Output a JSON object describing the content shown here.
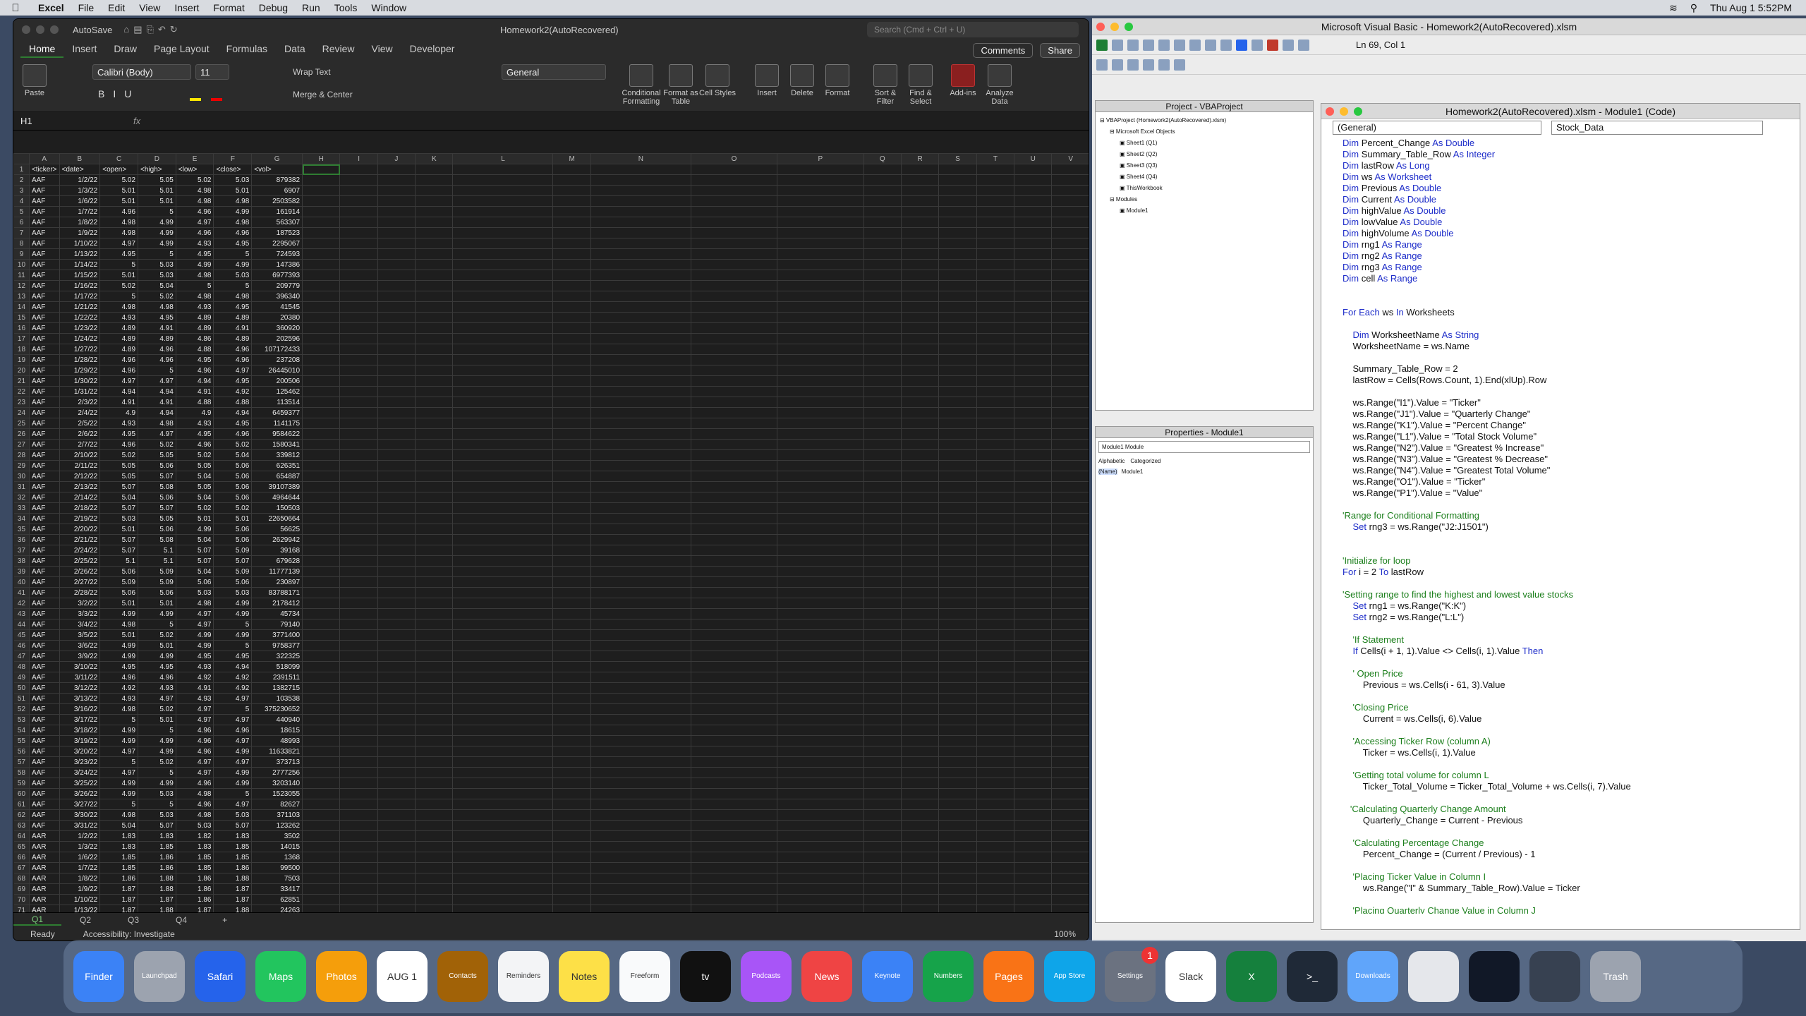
{
  "menubar": {
    "app": "Excel",
    "items": [
      "File",
      "Edit",
      "View",
      "Insert",
      "Format",
      "Debug",
      "Run",
      "Tools",
      "Window"
    ],
    "clock": "Thu Aug 1  5:52PM"
  },
  "excel": {
    "autosave": "AutoSave",
    "doc_title": "Homework2(AutoRecovered)",
    "search_placeholder": "Search (Cmd + Ctrl + U)",
    "tabs": [
      "Home",
      "Insert",
      "Draw",
      "Page Layout",
      "Formulas",
      "Data",
      "Review",
      "View",
      "Developer"
    ],
    "comments": "Comments",
    "share": "Share",
    "font": "Calibri (Body)",
    "size": "11",
    "format": "General",
    "wrap": "Wrap Text",
    "merge": "Merge & Center",
    "paste": "Paste",
    "groups": [
      "Conditional Formatting",
      "Format as Table",
      "Cell Styles",
      "Insert",
      "Delete",
      "Format",
      "Sort & Filter",
      "Find & Select",
      "Add-ins",
      "Analyze Data"
    ],
    "namebox": "H1",
    "fx": "fx",
    "columns": [
      "A",
      "B",
      "C",
      "D",
      "E",
      "F",
      "G",
      "H",
      "I",
      "J",
      "K",
      "L",
      "M",
      "N",
      "O",
      "P",
      "Q",
      "R",
      "S",
      "T",
      "U",
      "V"
    ],
    "headers": [
      "<ticker>",
      "<date>",
      "<open>",
      "<high>",
      "<low>",
      "<close>",
      "<vol>"
    ],
    "rows": [
      [
        "AAF",
        "1/2/22",
        "5.02",
        "5.05",
        "5.02",
        "5.03",
        "879382"
      ],
      [
        "AAF",
        "1/3/22",
        "5.01",
        "5.01",
        "4.98",
        "5.01",
        "6907"
      ],
      [
        "AAF",
        "1/6/22",
        "5.01",
        "5.01",
        "4.98",
        "4.98",
        "2503582"
      ],
      [
        "AAF",
        "1/7/22",
        "4.96",
        "5",
        "4.96",
        "4.99",
        "161914"
      ],
      [
        "AAF",
        "1/8/22",
        "4.98",
        "4.99",
        "4.97",
        "4.98",
        "563307"
      ],
      [
        "AAF",
        "1/9/22",
        "4.98",
        "4.99",
        "4.96",
        "4.96",
        "187523"
      ],
      [
        "AAF",
        "1/10/22",
        "4.97",
        "4.99",
        "4.93",
        "4.95",
        "2295067"
      ],
      [
        "AAF",
        "1/13/22",
        "4.95",
        "5",
        "4.95",
        "5",
        "724593"
      ],
      [
        "AAF",
        "1/14/22",
        "5",
        "5.03",
        "4.99",
        "4.99",
        "147386"
      ],
      [
        "AAF",
        "1/15/22",
        "5.01",
        "5.03",
        "4.98",
        "5.03",
        "6977393"
      ],
      [
        "AAF",
        "1/16/22",
        "5.02",
        "5.04",
        "5",
        "5",
        "209779"
      ],
      [
        "AAF",
        "1/17/22",
        "5",
        "5.02",
        "4.98",
        "4.98",
        "396340"
      ],
      [
        "AAF",
        "1/21/22",
        "4.98",
        "4.98",
        "4.93",
        "4.95",
        "41545"
      ],
      [
        "AAF",
        "1/22/22",
        "4.93",
        "4.95",
        "4.89",
        "4.89",
        "20380"
      ],
      [
        "AAF",
        "1/23/22",
        "4.89",
        "4.91",
        "4.89",
        "4.91",
        "360920"
      ],
      [
        "AAF",
        "1/24/22",
        "4.89",
        "4.89",
        "4.86",
        "4.89",
        "202596"
      ],
      [
        "AAF",
        "1/27/22",
        "4.89",
        "4.96",
        "4.88",
        "4.96",
        "107172433"
      ],
      [
        "AAF",
        "1/28/22",
        "4.96",
        "4.96",
        "4.95",
        "4.96",
        "237208"
      ],
      [
        "AAF",
        "1/29/22",
        "4.96",
        "5",
        "4.96",
        "4.97",
        "26445010"
      ],
      [
        "AAF",
        "1/30/22",
        "4.97",
        "4.97",
        "4.94",
        "4.95",
        "200506"
      ],
      [
        "AAF",
        "1/31/22",
        "4.94",
        "4.94",
        "4.91",
        "4.92",
        "125462"
      ],
      [
        "AAF",
        "2/3/22",
        "4.91",
        "4.91",
        "4.88",
        "4.88",
        "113514"
      ],
      [
        "AAF",
        "2/4/22",
        "4.9",
        "4.94",
        "4.9",
        "4.94",
        "6459377"
      ],
      [
        "AAF",
        "2/5/22",
        "4.93",
        "4.98",
        "4.93",
        "4.95",
        "1141175"
      ],
      [
        "AAF",
        "2/6/22",
        "4.95",
        "4.97",
        "4.95",
        "4.96",
        "9584622"
      ],
      [
        "AAF",
        "2/7/22",
        "4.96",
        "5.02",
        "4.96",
        "5.02",
        "1580341"
      ],
      [
        "AAF",
        "2/10/22",
        "5.02",
        "5.05",
        "5.02",
        "5.04",
        "339812"
      ],
      [
        "AAF",
        "2/11/22",
        "5.05",
        "5.06",
        "5.05",
        "5.06",
        "626351"
      ],
      [
        "AAF",
        "2/12/22",
        "5.05",
        "5.07",
        "5.04",
        "5.06",
        "654887"
      ],
      [
        "AAF",
        "2/13/22",
        "5.07",
        "5.08",
        "5.05",
        "5.06",
        "39107389"
      ],
      [
        "AAF",
        "2/14/22",
        "5.04",
        "5.06",
        "5.04",
        "5.06",
        "4964644"
      ],
      [
        "AAF",
        "2/18/22",
        "5.07",
        "5.07",
        "5.02",
        "5.02",
        "150503"
      ],
      [
        "AAF",
        "2/19/22",
        "5.03",
        "5.05",
        "5.01",
        "5.01",
        "22650664"
      ],
      [
        "AAF",
        "2/20/22",
        "5.01",
        "5.06",
        "4.99",
        "5.06",
        "56625"
      ],
      [
        "AAF",
        "2/21/22",
        "5.07",
        "5.08",
        "5.04",
        "5.06",
        "2629942"
      ],
      [
        "AAF",
        "2/24/22",
        "5.07",
        "5.1",
        "5.07",
        "5.09",
        "39168"
      ],
      [
        "AAF",
        "2/25/22",
        "5.1",
        "5.1",
        "5.07",
        "5.07",
        "679628"
      ],
      [
        "AAF",
        "2/26/22",
        "5.06",
        "5.09",
        "5.04",
        "5.09",
        "11777139"
      ],
      [
        "AAF",
        "2/27/22",
        "5.09",
        "5.09",
        "5.06",
        "5.06",
        "230897"
      ],
      [
        "AAF",
        "2/28/22",
        "5.06",
        "5.06",
        "5.03",
        "5.03",
        "83788171"
      ],
      [
        "AAF",
        "3/2/22",
        "5.01",
        "5.01",
        "4.98",
        "4.99",
        "2178412"
      ],
      [
        "AAF",
        "3/3/22",
        "4.99",
        "4.99",
        "4.97",
        "4.99",
        "45734"
      ],
      [
        "AAF",
        "3/4/22",
        "4.98",
        "5",
        "4.97",
        "5",
        "79140"
      ],
      [
        "AAF",
        "3/5/22",
        "5.01",
        "5.02",
        "4.99",
        "4.99",
        "3771400"
      ],
      [
        "AAF",
        "3/6/22",
        "4.99",
        "5.01",
        "4.99",
        "5",
        "9758377"
      ],
      [
        "AAF",
        "3/9/22",
        "4.99",
        "4.99",
        "4.95",
        "4.95",
        "322325"
      ],
      [
        "AAF",
        "3/10/22",
        "4.95",
        "4.95",
        "4.93",
        "4.94",
        "518099"
      ],
      [
        "AAF",
        "3/11/22",
        "4.96",
        "4.96",
        "4.92",
        "4.92",
        "2391511"
      ],
      [
        "AAF",
        "3/12/22",
        "4.92",
        "4.93",
        "4.91",
        "4.92",
        "1382715"
      ],
      [
        "AAF",
        "3/13/22",
        "4.93",
        "4.97",
        "4.93",
        "4.97",
        "103538"
      ],
      [
        "AAF",
        "3/16/22",
        "4.98",
        "5.02",
        "4.97",
        "5",
        "375230652"
      ],
      [
        "AAF",
        "3/17/22",
        "5",
        "5.01",
        "4.97",
        "4.97",
        "440940"
      ],
      [
        "AAF",
        "3/18/22",
        "4.99",
        "5",
        "4.96",
        "4.96",
        "18615"
      ],
      [
        "AAF",
        "3/19/22",
        "4.99",
        "4.99",
        "4.96",
        "4.97",
        "48993"
      ],
      [
        "AAF",
        "3/20/22",
        "4.97",
        "4.99",
        "4.96",
        "4.99",
        "11633821"
      ],
      [
        "AAF",
        "3/23/22",
        "5",
        "5.02",
        "4.97",
        "4.97",
        "373713"
      ],
      [
        "AAF",
        "3/24/22",
        "4.97",
        "5",
        "4.97",
        "4.99",
        "2777256"
      ],
      [
        "AAF",
        "3/25/22",
        "4.99",
        "4.99",
        "4.96",
        "4.99",
        "3203140"
      ],
      [
        "AAF",
        "3/26/22",
        "4.99",
        "5.03",
        "4.98",
        "5",
        "1523055"
      ],
      [
        "AAF",
        "3/27/22",
        "5",
        "5",
        "4.96",
        "4.97",
        "82627"
      ],
      [
        "AAF",
        "3/30/22",
        "4.98",
        "5.03",
        "4.98",
        "5.03",
        "371103"
      ],
      [
        "AAF",
        "3/31/22",
        "5.04",
        "5.07",
        "5.03",
        "5.07",
        "123262"
      ],
      [
        "AAR",
        "1/2/22",
        "1.83",
        "1.83",
        "1.82",
        "1.83",
        "3502"
      ],
      [
        "AAR",
        "1/3/22",
        "1.83",
        "1.85",
        "1.83",
        "1.85",
        "14015"
      ],
      [
        "AAR",
        "1/6/22",
        "1.85",
        "1.86",
        "1.85",
        "1.85",
        "1368"
      ],
      [
        "AAR",
        "1/7/22",
        "1.85",
        "1.86",
        "1.85",
        "1.86",
        "99500"
      ],
      [
        "AAR",
        "1/8/22",
        "1.86",
        "1.88",
        "1.86",
        "1.88",
        "7503"
      ],
      [
        "AAR",
        "1/9/22",
        "1.87",
        "1.88",
        "1.86",
        "1.87",
        "33417"
      ],
      [
        "AAR",
        "1/10/22",
        "1.87",
        "1.87",
        "1.86",
        "1.87",
        "62851"
      ],
      [
        "AAR",
        "1/13/22",
        "1.87",
        "1.88",
        "1.87",
        "1.88",
        "24263"
      ]
    ],
    "sheets": [
      "Q1",
      "Q2",
      "Q3",
      "Q4"
    ],
    "status": "Ready",
    "accessibility": "Accessibility: Investigate",
    "zoom": "100%"
  },
  "vba": {
    "title": "Microsoft Visual Basic - Homework2(AutoRecovered).xlsm",
    "position": "Ln 69, Col 1",
    "project_title": "Project - VBAProject",
    "tree": [
      "VBAProject (Homework2(AutoRecovered).xlsm)",
      "Microsoft Excel Objects",
      "Sheet1 (Q1)",
      "Sheet2 (Q2)",
      "Sheet3 (Q3)",
      "Sheet4 (Q4)",
      "ThisWorkbook",
      "Modules",
      "Module1"
    ],
    "props_title": "Properties - Module1",
    "props_object": "Module1  Module",
    "props_tabs": [
      "Alphabetic",
      "Categorized"
    ],
    "props_name": "(Name)",
    "props_value": "Module1",
    "code_title": "Homework2(AutoRecovered).xlsm - Module1 (Code)",
    "dd_left": "(General)",
    "dd_right": "Stock_Data",
    "code": [
      {
        "t": "Dim Percent_Change As Double",
        "c": "d"
      },
      {
        "t": "Dim Summary_Table_Row As Integer",
        "c": "d"
      },
      {
        "t": "Dim lastRow As Long",
        "c": "d"
      },
      {
        "t": "Dim ws As Worksheet",
        "c": "d"
      },
      {
        "t": "Dim Previous As Double",
        "c": "d"
      },
      {
        "t": "Dim Current As Double",
        "c": "d"
      },
      {
        "t": "Dim highValue As Double",
        "c": "d"
      },
      {
        "t": "Dim lowValue As Double",
        "c": "d"
      },
      {
        "t": "Dim highVolume As Double",
        "c": "d"
      },
      {
        "t": "Dim rng1 As Range",
        "c": "d"
      },
      {
        "t": "Dim rng2 As Range",
        "c": "d"
      },
      {
        "t": "Dim rng3 As Range",
        "c": "d"
      },
      {
        "t": "Dim cell As Range",
        "c": "d"
      },
      {
        "t": "",
        "c": "n"
      },
      {
        "t": "",
        "c": "n"
      },
      {
        "t": "For Each ws In Worksheets",
        "c": "k"
      },
      {
        "t": "",
        "c": "n"
      },
      {
        "t": "    Dim WorksheetName As String",
        "c": "d"
      },
      {
        "t": "    WorksheetName = ws.Name",
        "c": "n"
      },
      {
        "t": "",
        "c": "n"
      },
      {
        "t": "    Summary_Table_Row = 2",
        "c": "n"
      },
      {
        "t": "    lastRow = Cells(Rows.Count, 1).End(xlUp).Row",
        "c": "n"
      },
      {
        "t": "",
        "c": "n"
      },
      {
        "t": "    ws.Range(\"I1\").Value = \"Ticker\"",
        "c": "n"
      },
      {
        "t": "    ws.Range(\"J1\").Value = \"Quarterly Change\"",
        "c": "n"
      },
      {
        "t": "    ws.Range(\"K1\").Value = \"Percent Change\"",
        "c": "n"
      },
      {
        "t": "    ws.Range(\"L1\").Value = \"Total Stock Volume\"",
        "c": "n"
      },
      {
        "t": "    ws.Range(\"N2\").Value = \"Greatest % Increase\"",
        "c": "n"
      },
      {
        "t": "    ws.Range(\"N3\").Value = \"Greatest % Decrease\"",
        "c": "n"
      },
      {
        "t": "    ws.Range(\"N4\").Value = \"Greatest Total Volume\"",
        "c": "n"
      },
      {
        "t": "    ws.Range(\"O1\").Value = \"Ticker\"",
        "c": "n"
      },
      {
        "t": "    ws.Range(\"P1\").Value = \"Value\"",
        "c": "n"
      },
      {
        "t": "",
        "c": "n"
      },
      {
        "t": "'Range for Conditional Formatting",
        "c": "c"
      },
      {
        "t": "    Set rng3 = ws.Range(\"J2:J1501\")",
        "c": "s"
      },
      {
        "t": "",
        "c": "n"
      },
      {
        "t": "",
        "c": "n"
      },
      {
        "t": "'Initialize for loop",
        "c": "c"
      },
      {
        "t": "For i = 2 To lastRow",
        "c": "f"
      },
      {
        "t": "",
        "c": "n"
      },
      {
        "t": "'Setting range to find the highest and lowest value stocks",
        "c": "c"
      },
      {
        "t": "    Set rng1 = ws.Range(\"K:K\")",
        "c": "s"
      },
      {
        "t": "    Set rng2 = ws.Range(\"L:L\")",
        "c": "s"
      },
      {
        "t": "",
        "c": "n"
      },
      {
        "t": "    'If Statement",
        "c": "c"
      },
      {
        "t": "    If Cells(i + 1, 1).Value <> Cells(i, 1).Value Then",
        "c": "i"
      },
      {
        "t": "",
        "c": "n"
      },
      {
        "t": "    ' Open Price",
        "c": "c"
      },
      {
        "t": "        Previous = ws.Cells(i - 61, 3).Value",
        "c": "n"
      },
      {
        "t": "",
        "c": "n"
      },
      {
        "t": "    'Closing Price",
        "c": "c"
      },
      {
        "t": "        Current = ws.Cells(i, 6).Value",
        "c": "n"
      },
      {
        "t": "",
        "c": "n"
      },
      {
        "t": "    'Accessing Ticker Row (column A)",
        "c": "c"
      },
      {
        "t": "        Ticker = ws.Cells(i, 1).Value",
        "c": "n"
      },
      {
        "t": "",
        "c": "n"
      },
      {
        "t": "    'Getting total volume for column L",
        "c": "c"
      },
      {
        "t": "        Ticker_Total_Volume = Ticker_Total_Volume + ws.Cells(i, 7).Value",
        "c": "n"
      },
      {
        "t": "",
        "c": "n"
      },
      {
        "t": "   'Calculating Quarterly Change Amount",
        "c": "c"
      },
      {
        "t": "        Quarterly_Change = Current - Previous",
        "c": "n"
      },
      {
        "t": "",
        "c": "n"
      },
      {
        "t": "    'Calculating Percentage Change",
        "c": "c"
      },
      {
        "t": "        Percent_Change = (Current / Previous) - 1",
        "c": "n"
      },
      {
        "t": "",
        "c": "n"
      },
      {
        "t": "    'Placing Ticker Value in Column I",
        "c": "c"
      },
      {
        "t": "        ws.Range(\"I\" & Summary_Table_Row).Value = Ticker",
        "c": "n"
      },
      {
        "t": "",
        "c": "n"
      },
      {
        "t": "    'Placing Quarterly Change Value in Column J",
        "c": "c"
      }
    ]
  },
  "dock": [
    {
      "name": "finder",
      "label": "Finder",
      "color": "#3b82f6"
    },
    {
      "name": "launchpad",
      "label": "Launchpad",
      "color": "#9ca3af"
    },
    {
      "name": "safari",
      "label": "Safari",
      "color": "#2563eb"
    },
    {
      "name": "maps",
      "label": "Maps",
      "color": "#22c55e"
    },
    {
      "name": "photos",
      "label": "Photos",
      "color": "#f59e0b"
    },
    {
      "name": "calendar",
      "label": "AUG 1",
      "color": "#ffffff"
    },
    {
      "name": "contacts",
      "label": "Contacts",
      "color": "#a16207"
    },
    {
      "name": "reminders",
      "label": "Reminders",
      "color": "#f3f4f6"
    },
    {
      "name": "notes",
      "label": "Notes",
      "color": "#fde047"
    },
    {
      "name": "freeform",
      "label": "Freeform",
      "color": "#f9fafb"
    },
    {
      "name": "tv",
      "label": "tv",
      "color": "#111111"
    },
    {
      "name": "podcasts",
      "label": "Podcasts",
      "color": "#a855f7"
    },
    {
      "name": "news",
      "label": "News",
      "color": "#ef4444"
    },
    {
      "name": "keynote",
      "label": "Keynote",
      "color": "#3b82f6"
    },
    {
      "name": "numbers",
      "label": "Numbers",
      "color": "#16a34a"
    },
    {
      "name": "pages",
      "label": "Pages",
      "color": "#f97316"
    },
    {
      "name": "app-store",
      "label": "App Store",
      "color": "#0ea5e9"
    },
    {
      "name": "settings",
      "label": "Settings",
      "color": "#6b7280",
      "badge": "1"
    },
    {
      "name": "slack",
      "label": "Slack",
      "color": "#ffffff"
    },
    {
      "name": "excel",
      "label": "X",
      "color": "#15803d"
    },
    {
      "name": "terminal",
      "label": ">_",
      "color": "#1f2937"
    },
    {
      "name": "downloads",
      "label": "Downloads",
      "color": "#60a5fa"
    },
    {
      "name": "window-1",
      "label": "",
      "color": "#e5e7eb"
    },
    {
      "name": "window-2",
      "label": "",
      "color": "#111827"
    },
    {
      "name": "window-3",
      "label": "",
      "color": "#374151"
    },
    {
      "name": "trash",
      "label": "Trash",
      "color": "#9ca3af"
    }
  ]
}
